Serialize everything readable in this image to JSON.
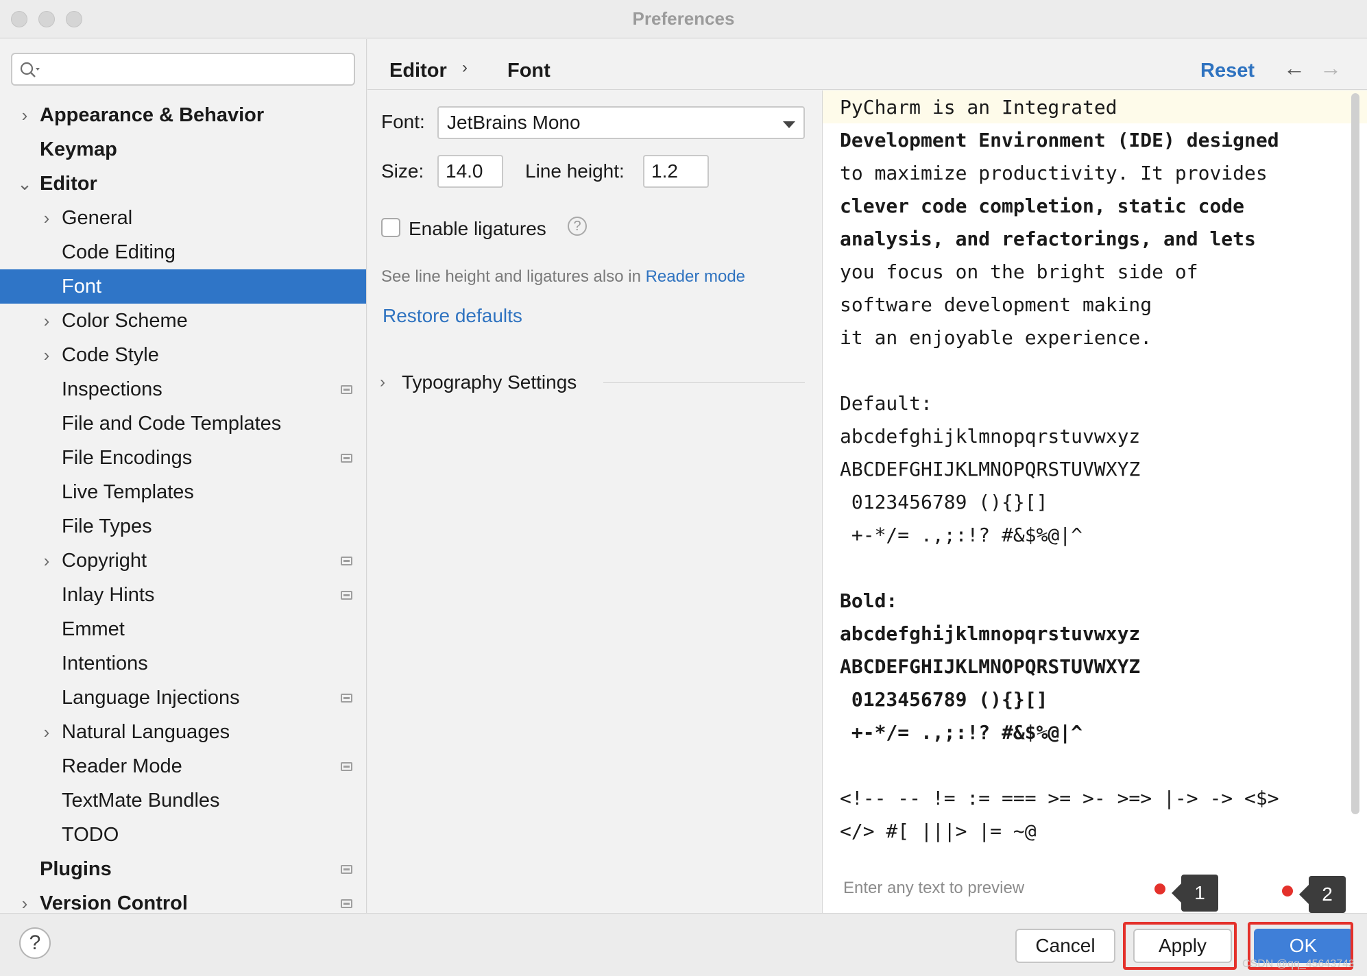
{
  "window": {
    "title": "Preferences"
  },
  "sidebar": {
    "items": [
      {
        "label": "Appearance & Behavior",
        "level": 0,
        "chevron": "right"
      },
      {
        "label": "Keymap",
        "level": 0,
        "chevron": ""
      },
      {
        "label": "Editor",
        "level": 0,
        "chevron": "down"
      },
      {
        "label": "General",
        "level": 1,
        "chevron": "right"
      },
      {
        "label": "Code Editing",
        "level": 1,
        "chevron": ""
      },
      {
        "label": "Font",
        "level": 1,
        "chevron": "",
        "selected": true
      },
      {
        "label": "Color Scheme",
        "level": 1,
        "chevron": "right"
      },
      {
        "label": "Code Style",
        "level": 1,
        "chevron": "right"
      },
      {
        "label": "Inspections",
        "level": 1,
        "chevron": "",
        "project_icon": true
      },
      {
        "label": "File and Code Templates",
        "level": 1,
        "chevron": ""
      },
      {
        "label": "File Encodings",
        "level": 1,
        "chevron": "",
        "project_icon": true
      },
      {
        "label": "Live Templates",
        "level": 1,
        "chevron": ""
      },
      {
        "label": "File Types",
        "level": 1,
        "chevron": ""
      },
      {
        "label": "Copyright",
        "level": 1,
        "chevron": "right",
        "project_icon": true
      },
      {
        "label": "Inlay Hints",
        "level": 1,
        "chevron": "",
        "project_icon": true
      },
      {
        "label": "Emmet",
        "level": 1,
        "chevron": ""
      },
      {
        "label": "Intentions",
        "level": 1,
        "chevron": ""
      },
      {
        "label": "Language Injections",
        "level": 1,
        "chevron": "",
        "project_icon": true
      },
      {
        "label": "Natural Languages",
        "level": 1,
        "chevron": "right"
      },
      {
        "label": "Reader Mode",
        "level": 1,
        "chevron": "",
        "project_icon": true
      },
      {
        "label": "TextMate Bundles",
        "level": 1,
        "chevron": ""
      },
      {
        "label": "TODO",
        "level": 1,
        "chevron": ""
      },
      {
        "label": "Plugins",
        "level": 0,
        "chevron": "",
        "project_icon": true
      },
      {
        "label": "Version Control",
        "level": 0,
        "chevron": "right",
        "project_icon": true
      }
    ]
  },
  "header": {
    "breadcrumb_1": "Editor",
    "breadcrumb_sep": "›",
    "breadcrumb_2": "Font",
    "reset_label": "Reset",
    "back_icon": "←",
    "forward_icon": "→"
  },
  "settings": {
    "font_label": "Font:",
    "font_value": "JetBrains Mono",
    "size_label": "Size:",
    "size_value": "14.0",
    "line_height_label": "Line height:",
    "line_height_value": "1.2",
    "ligatures_label": "Enable ligatures",
    "ligatures_checked": false,
    "help_icon": "?",
    "hint_text": "See line height and ligatures also in ",
    "hint_link": "Reader mode",
    "restore_label": "Restore defaults",
    "typography_label": "Typography Settings"
  },
  "preview": {
    "lines": [
      "PyCharm is an Integrated",
      "Development Environment (IDE) designed",
      "to maximize productivity. It provides",
      "clever code completion, static code",
      "analysis, and refactorings, and lets",
      "you focus on the bright side of",
      "software development making",
      "it an enjoyable experience.",
      "Default:",
      "abcdefghijklmnopqrstuvwxyz",
      "ABCDEFGHIJKLMNOPQRSTUVWXYZ",
      " 0123456789 (){}[]",
      " +-*/= .,;:!? #&$%@|^",
      "Bold:",
      "abcdefghijklmnopqrstuvwxyz",
      "ABCDEFGHIJKLMNOPQRSTUVWXYZ",
      " 0123456789 (){}[]",
      " +-*/= .,;:!? #&$%@|^",
      "<!-- -- != := === >= >- >=> |-> -> <$>",
      "</> #[ |||> |= ~@"
    ],
    "placeholder": "Enter any text to preview"
  },
  "annotations": {
    "badge_1": "1",
    "badge_2": "2",
    "highlight_color": "#e4312b"
  },
  "footer": {
    "help_label": "?",
    "cancel_label": "Cancel",
    "apply_label": "Apply",
    "ok_label": "OK"
  },
  "watermark": "CSDN @qq_45643743",
  "colors": {
    "accent": "#2f75c7",
    "link": "#2f73c0",
    "primary_button": "#3f7fd8"
  }
}
